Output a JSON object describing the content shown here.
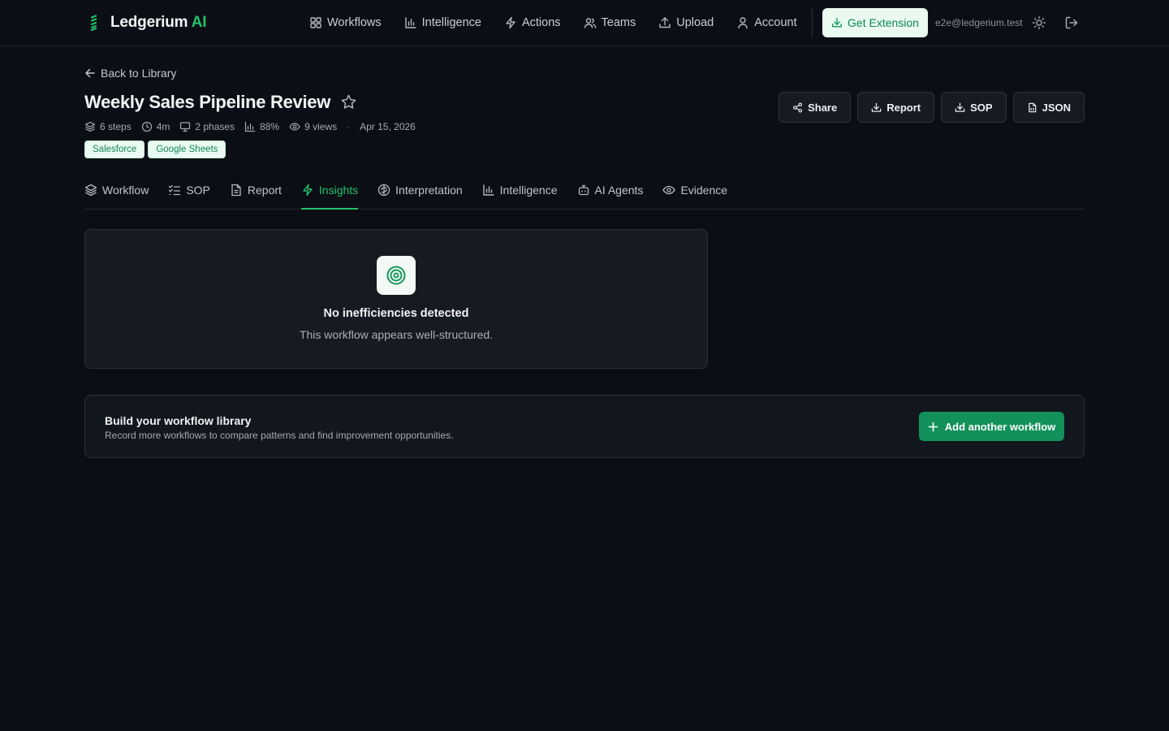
{
  "brand": {
    "name": "Ledgerium",
    "suffix": "AI",
    "accent": "#22c06b"
  },
  "nav": {
    "items": [
      {
        "label": "Workflows",
        "icon": "grid-icon"
      },
      {
        "label": "Intelligence",
        "icon": "bar-chart-icon"
      },
      {
        "label": "Actions",
        "icon": "bolt-icon"
      },
      {
        "label": "Teams",
        "icon": "users-icon"
      },
      {
        "label": "Upload",
        "icon": "upload-icon"
      },
      {
        "label": "Account",
        "icon": "user-icon"
      }
    ],
    "extension_label": "Get Extension",
    "user_email": "e2e@ledgerium.test"
  },
  "header": {
    "back_label": "Back to Library",
    "title": "Weekly Sales Pipeline Review",
    "meta": {
      "steps": "6 steps",
      "duration": "4m",
      "phases": "2 phases",
      "score": "88%",
      "views": "9 views",
      "date": "Apr 15, 2026"
    },
    "tags": [
      "Salesforce",
      "Google Sheets"
    ],
    "actions": {
      "share": "Share",
      "report": "Report",
      "sop": "SOP",
      "json": "JSON"
    }
  },
  "tabs": [
    {
      "label": "Workflow",
      "icon": "layers-icon",
      "active": false
    },
    {
      "label": "SOP",
      "icon": "checklist-icon",
      "active": false
    },
    {
      "label": "Report",
      "icon": "document-icon",
      "active": false
    },
    {
      "label": "Insights",
      "icon": "bolt-icon",
      "active": true
    },
    {
      "label": "Interpretation",
      "icon": "brain-icon",
      "active": false
    },
    {
      "label": "Intelligence",
      "icon": "bar-chart-icon",
      "active": false
    },
    {
      "label": "AI Agents",
      "icon": "bot-icon",
      "active": false
    },
    {
      "label": "Evidence",
      "icon": "eye-icon",
      "active": false
    }
  ],
  "insights": {
    "title": "No inefficiencies detected",
    "subtitle": "This workflow appears well-structured."
  },
  "library": {
    "title": "Build your workflow library",
    "subtitle": "Record more workflows to compare patterns and find improvement opportunities.",
    "button_label": "Add another workflow"
  }
}
